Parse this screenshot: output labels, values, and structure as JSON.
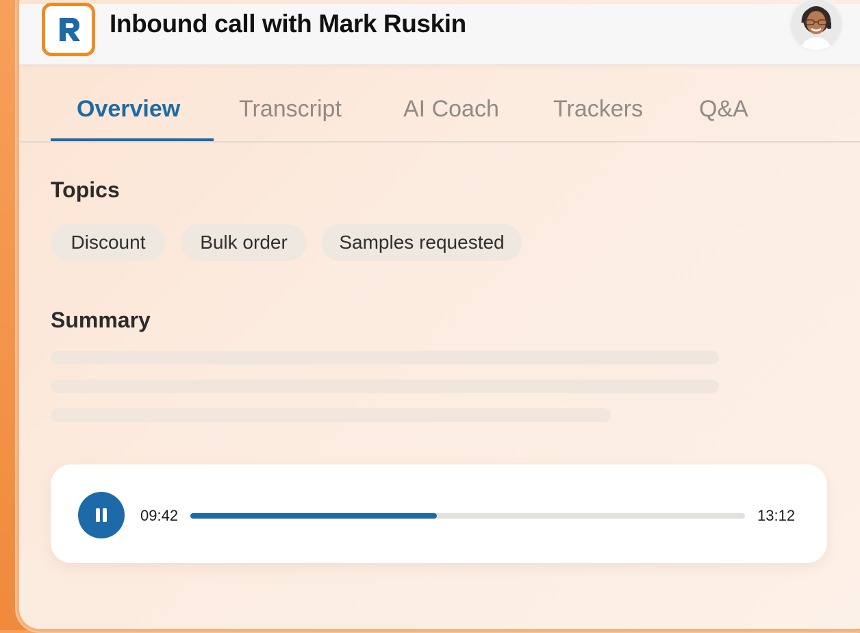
{
  "header": {
    "title": "Inbound call with Mark Ruskin",
    "logo_icon": "r-logo-icon",
    "avatar_icon": "agent-avatar-icon"
  },
  "tabs": [
    {
      "label": "Overview",
      "active": true
    },
    {
      "label": "Transcript",
      "active": false
    },
    {
      "label": "AI Coach",
      "active": false
    },
    {
      "label": "Trackers",
      "active": false
    },
    {
      "label": "Q&A",
      "active": false
    }
  ],
  "topics": {
    "title": "Topics",
    "chips": [
      "Discount",
      "Bulk order",
      "Samples requested"
    ]
  },
  "summary": {
    "title": "Summary"
  },
  "player": {
    "current_time": "09:42",
    "total_time": "13:12",
    "progress": 0.445,
    "control_icon": "pause-icon"
  },
  "colors": {
    "accent": "#1c6aa8",
    "brand_orange": "#f08a24",
    "background": "#fbe9dc"
  }
}
